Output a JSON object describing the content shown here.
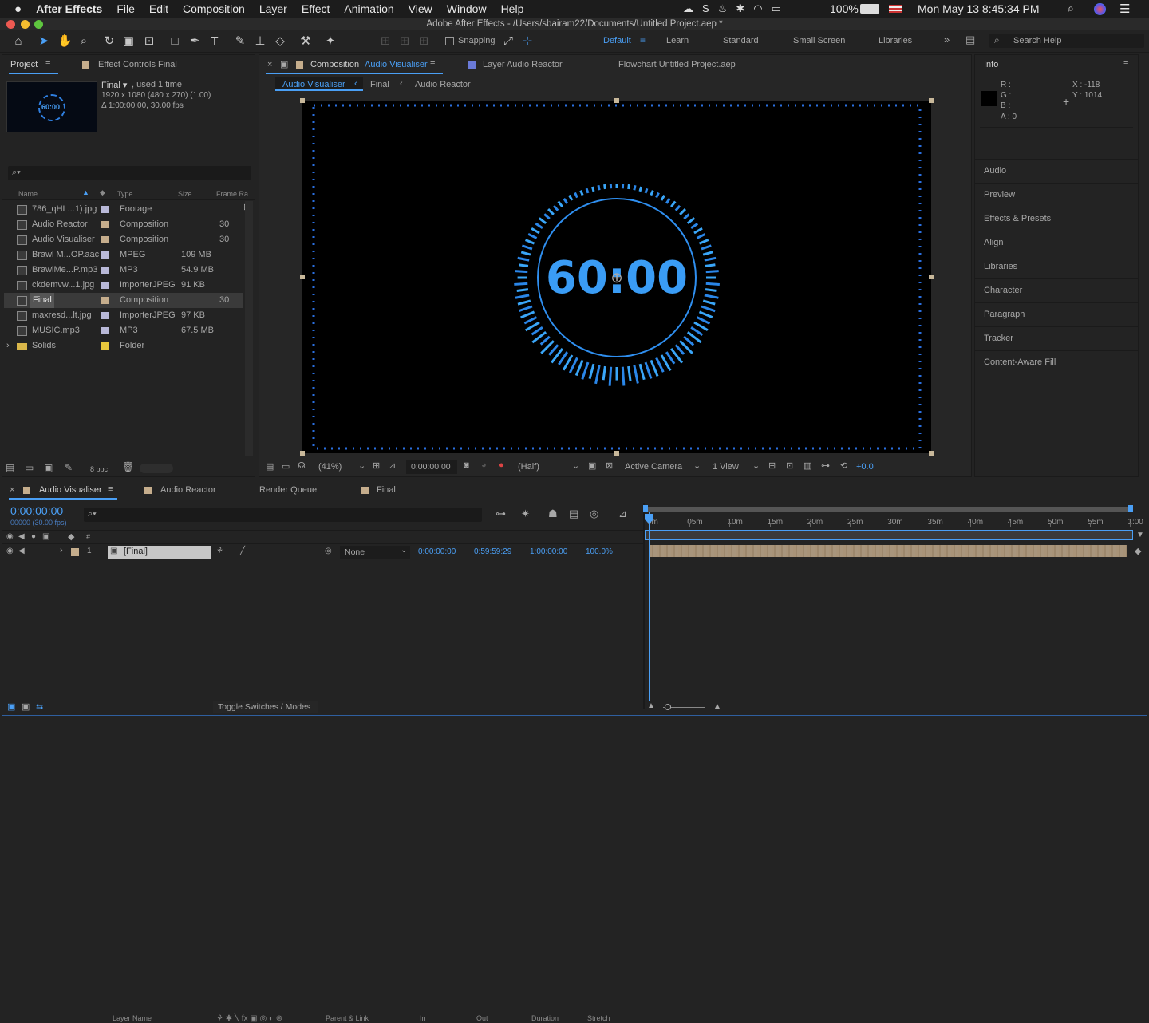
{
  "menubar": {
    "apple": "",
    "app": "After Effects",
    "items": [
      "File",
      "Edit",
      "Composition",
      "Layer",
      "Effect",
      "Animation",
      "View",
      "Window",
      "Help"
    ],
    "battery": "100%",
    "clock": "Mon May 13  8:45:34 PM"
  },
  "window_title": "Adobe After Effects - /Users/sbairam22/Documents/Untitled Project.aep *",
  "toolbar": {
    "snapping": "Snapping",
    "workspaces": [
      "Default",
      "Learn",
      "Standard",
      "Small Screen",
      "Libraries"
    ],
    "search_placeholder": "Search Help"
  },
  "project": {
    "tab_project": "Project",
    "tab_effect_controls": "Effect Controls Final",
    "thumb_text": "60:00",
    "item_name": "Final ▾",
    "used": ", used 1 time",
    "dims": "1920 x 1080  (480 x 270) (1.00)",
    "duration": "Δ 1:00:00:00, 30.00 fps",
    "columns": [
      "Name",
      "Type",
      "Size",
      "Frame Ra..."
    ],
    "rows": [
      {
        "name": "786_qHL...1).jpg",
        "type": "Footage",
        "size": "",
        "fr": "",
        "label": "#b9b9d8"
      },
      {
        "name": "Audio Reactor",
        "type": "Composition",
        "size": "",
        "fr": "30",
        "label": "#c5ad8c"
      },
      {
        "name": "Audio Visualiser",
        "type": "Composition",
        "size": "",
        "fr": "30",
        "label": "#c5ad8c"
      },
      {
        "name": "Brawl M...OP.aac",
        "type": "MPEG",
        "size": "109 MB",
        "fr": "",
        "label": "#b9b9d8"
      },
      {
        "name": "BrawlMe...P.mp3",
        "type": "MP3",
        "size": "54.9 MB",
        "fr": "",
        "label": "#b9b9d8"
      },
      {
        "name": "ckdemvw...1.jpg",
        "type": "ImporterJPEG",
        "size": "91 KB",
        "fr": "",
        "label": "#b9b9d8"
      },
      {
        "name": "Final",
        "type": "Composition",
        "size": "",
        "fr": "30",
        "label": "#c5ad8c"
      },
      {
        "name": "maxresd...lt.jpg",
        "type": "ImporterJPEG",
        "size": "97 KB",
        "fr": "",
        "label": "#b9b9d8"
      },
      {
        "name": "MUSIC.mp3",
        "type": "MP3",
        "size": "67.5 MB",
        "fr": "",
        "label": "#b9b9d8"
      },
      {
        "name": "Solids",
        "type": "Folder",
        "size": "",
        "fr": "",
        "label": "#e8c73c"
      }
    ],
    "bpc": "8 bpc"
  },
  "comp": {
    "tab_comp_prefix": "Composition",
    "tab_comp_name": "Audio Visualiser",
    "tab_layer": "Layer Audio Reactor",
    "tab_flow": "Flowchart Untitled Project.aep",
    "crumbs": [
      "Audio Visualiser",
      "Final",
      "Audio Reactor"
    ],
    "timer": "60:00",
    "zoom": "(41%)",
    "time": "0:00:00:00",
    "res": "(Half)",
    "camera": "Active Camera",
    "views": "1 View",
    "exposure": "+0.0"
  },
  "info": {
    "title": "Info",
    "r": "R :",
    "g": "G :",
    "b": "B :",
    "a": "A :  0",
    "x": "X :  -118",
    "y": "Y :  1014",
    "panels": [
      "Audio",
      "Preview",
      "Effects & Presets",
      "Align",
      "Libraries",
      "Character",
      "Paragraph",
      "Tracker",
      "Content-Aware Fill"
    ]
  },
  "timeline": {
    "tabs": [
      "Audio Visualiser",
      "Audio Reactor",
      "Render Queue",
      "Final"
    ],
    "timecode": "0:00:00:00",
    "fps": "00000 (30.00 fps)",
    "ruler": [
      "0m",
      "05m",
      "10m",
      "15m",
      "20m",
      "25m",
      "30m",
      "35m",
      "40m",
      "45m",
      "50m",
      "55m",
      "1:00"
    ],
    "headers": [
      "Layer Name",
      "Parent & Link",
      "In",
      "Out",
      "Duration",
      "Stretch"
    ],
    "layer": {
      "num": "1",
      "name": "[Final]",
      "parent": "None",
      "in": "0:00:00:00",
      "out": "0:59:59:29",
      "duration": "1:00:00:00",
      "stretch": "100.0%"
    },
    "toggle": "Toggle Switches / Modes"
  }
}
